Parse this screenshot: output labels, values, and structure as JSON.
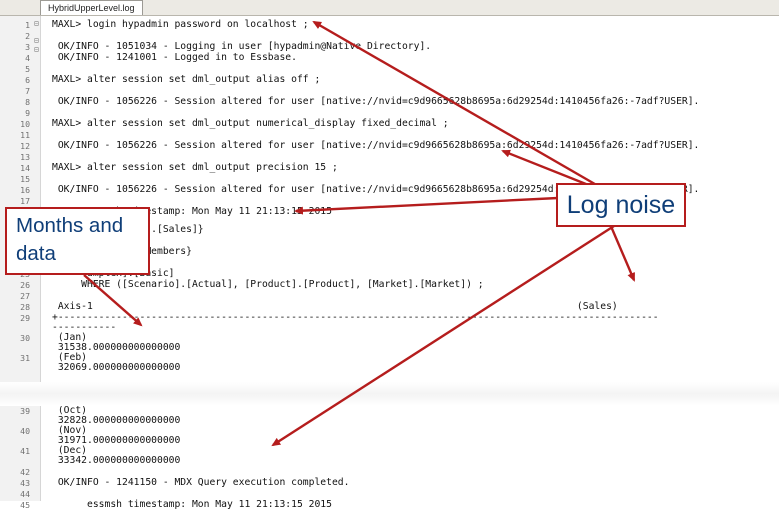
{
  "tab": {
    "label": "HybridUpperLevel.log"
  },
  "lines": [
    {
      "n": "1",
      "text": "MAXL> login hypadmin password on localhost ;"
    },
    {
      "n": "2",
      "text": ""
    },
    {
      "n": "3",
      "text": " OK/INFO - 1051034 - Logging in user [hypadmin@Native Directory]."
    },
    {
      "n": "4",
      "text": " OK/INFO - 1241001 - Logged in to Essbase."
    },
    {
      "n": "5",
      "text": ""
    },
    {
      "n": "6",
      "text": "MAXL> alter session set dml_output alias off ;"
    },
    {
      "n": "7",
      "text": ""
    },
    {
      "n": "8",
      "text": " OK/INFO - 1056226 - Session altered for user [native://nvid=c9d9665628b8695a:6d29254d:1410456fa26:-7adf?USER]."
    },
    {
      "n": "9",
      "text": ""
    },
    {
      "n": "10",
      "text": "MAXL> alter session set dml_output numerical_display fixed_decimal ;"
    },
    {
      "n": "11",
      "text": ""
    },
    {
      "n": "12",
      "text": " OK/INFO - 1056226 - Session altered for user [native://nvid=c9d9665628b8695a:6d29254d:1410456fa26:-7adf?USER]."
    },
    {
      "n": "13",
      "text": ""
    },
    {
      "n": "14",
      "text": "MAXL> alter session set dml_output precision 15 ;"
    },
    {
      "n": "15",
      "text": ""
    },
    {
      "n": "16",
      "text": " OK/INFO - 1056226 - Session altered for user [native://nvid=c9d9665628b8695a:6d29254d:1410456fa26:-7adf?USER]."
    },
    {
      "n": "17",
      "text": ""
    },
    {
      "n": "18",
      "text": ""
    },
    {
      "n": "19",
      "text": "      essmsh timestamp: Mon May 11 21:13:15 2015"
    },
    {
      "n": "20",
      "text": ""
    },
    {
      "n": "21",
      "text": "      {[Measures].[Sales]}"
    },
    {
      "n": "22",
      "text": "      LUMNS,"
    },
    {
      "n": "23",
      "text": "      Levels(0).Members}"
    },
    {
      "n": "24",
      "text": ""
    },
    {
      "n": "25",
      "text": "      ampleH].[Basic]"
    },
    {
      "n": "26",
      "text": "     WHERE ([Scenario].[Actual], [Product].[Product], [Market].[Market]) ;"
    },
    {
      "n": "27",
      "text": ""
    },
    {
      "n": "28",
      "text": " Axis-1                                                                                   (Sales)"
    },
    {
      "n": "29",
      "text": "+-------------------------------------------------------------------------------------------------------"
    },
    {
      "n": "",
      "text": "-----------"
    },
    {
      "n": "30",
      "text": " (Jan)"
    },
    {
      "n": "",
      "text": " 31538.000000000000000"
    },
    {
      "n": "31",
      "text": " (Feb)"
    },
    {
      "n": "",
      "text": " 32069.000000000000000"
    },
    {
      "n": "39",
      "text": " (Oct)"
    },
    {
      "n": "",
      "text": " 32828.000000000000000"
    },
    {
      "n": "40",
      "text": " (Nov)"
    },
    {
      "n": "",
      "text": " 31971.000000000000000"
    },
    {
      "n": "41",
      "text": " (Dec)"
    },
    {
      "n": "",
      "text": " 33342.000000000000000"
    },
    {
      "n": "42",
      "text": ""
    },
    {
      "n": "43",
      "text": " OK/INFO - 1241150 - MDX Query execution completed."
    },
    {
      "n": "44",
      "text": ""
    },
    {
      "n": "45",
      "text": "      essmsh timestamp: Mon May 11 21:13:15 2015"
    }
  ],
  "callouts": {
    "log_noise": "Log noise",
    "months_line1": "Months and",
    "months_line2": "data"
  },
  "colors": {
    "arrow": "#b51d1d",
    "callout_text": "#0f3e78"
  }
}
